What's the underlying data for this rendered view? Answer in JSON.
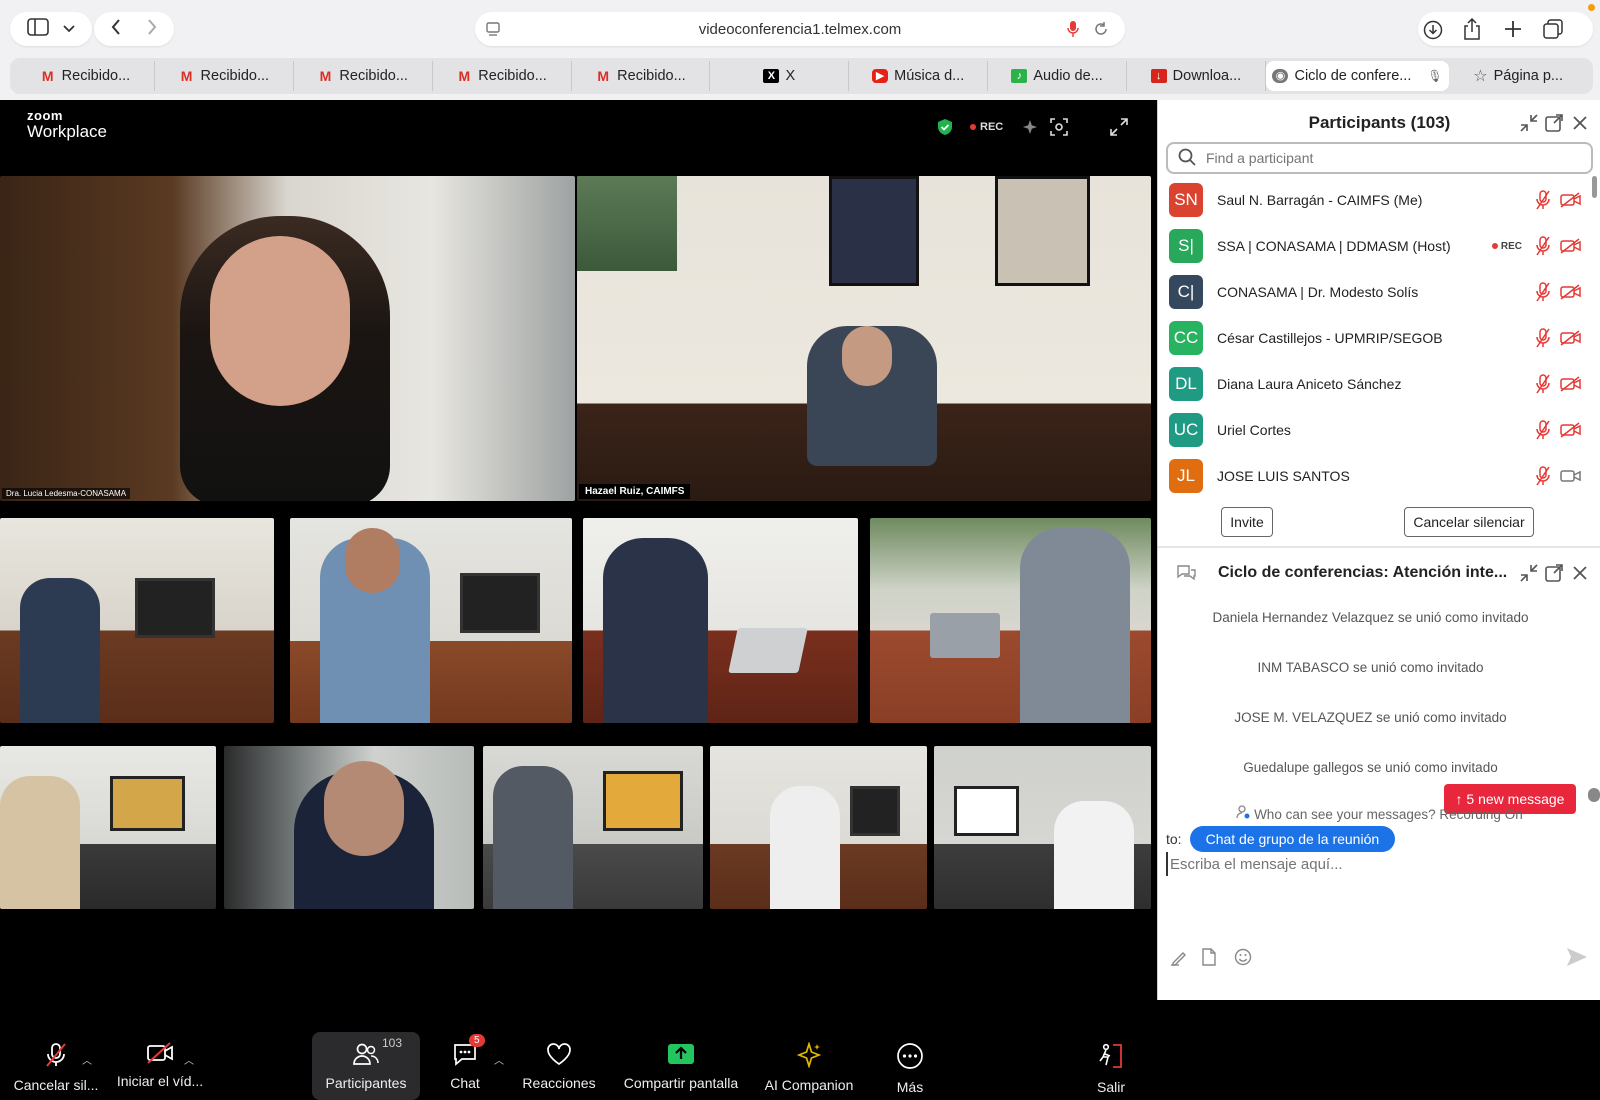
{
  "browser": {
    "url": "videoconferencia1.telmex.com",
    "tabs": [
      {
        "label": "Recibido...",
        "icon": "gmail-icon"
      },
      {
        "label": "Recibido...",
        "icon": "gmail-icon"
      },
      {
        "label": "Recibido...",
        "icon": "gmail-icon"
      },
      {
        "label": "Recibido...",
        "icon": "gmail-icon"
      },
      {
        "label": "Recibido...",
        "icon": "gmail-icon"
      },
      {
        "label": "X",
        "icon": "x-icon"
      },
      {
        "label": "Música d...",
        "icon": "youtube-icon"
      },
      {
        "label": "Audio de...",
        "icon": "audio-icon"
      },
      {
        "label": "Downloa...",
        "icon": "download-icon"
      },
      {
        "label": "Ciclo de confere...",
        "icon": "zoom-icon",
        "active": true
      },
      {
        "label": "Página p...",
        "icon": "star-icon"
      }
    ]
  },
  "zoom": {
    "logo_top": "zoom",
    "logo_bottom": "Workplace",
    "rec_label": "REC",
    "tiles": [
      {
        "name": "Dra. Lucia Ledesma-CONASAMA"
      },
      {
        "name": "Hazael Ruiz, CAIMFS"
      }
    ],
    "toolbar": {
      "mute": "Cancelar sil...",
      "video": "Iniciar el víd...",
      "participants": "Participantes",
      "participants_count": "103",
      "chat": "Chat",
      "chat_badge": "5",
      "reactions": "Reacciones",
      "share": "Compartir pantalla",
      "ai": "AI Companion",
      "more": "Más",
      "leave": "Salir"
    }
  },
  "participants": {
    "title": "Participants (103)",
    "search_placeholder": "Find a participant",
    "list": [
      {
        "initials": "SN",
        "name": "Saul N. Barragán - CAIMFS (Me)",
        "color": "#d9432f",
        "rec": "",
        "video": "off"
      },
      {
        "initials": "S|",
        "name": "SSA | CONASAMA | DDMASM (Host)",
        "color": "#27a85b",
        "rec": "REC",
        "video": "off"
      },
      {
        "initials": "C|",
        "name": "CONASAMA | Dr. Modesto Solís",
        "color": "#36485e",
        "rec": "",
        "video": "off"
      },
      {
        "initials": "CC",
        "name": "César Castillejos - UPMRIP/SEGOB",
        "color": "#27b35f",
        "rec": "",
        "video": "off"
      },
      {
        "initials": "DL",
        "name": "Diana Laura Aniceto Sánchez",
        "color": "#1f9a83",
        "rec": "",
        "video": "off"
      },
      {
        "initials": "UC",
        "name": "Uriel Cortes",
        "color": "#1f9a83",
        "rec": "",
        "video": "off"
      },
      {
        "initials": "JL",
        "name": "JOSE LUIS SANTOS",
        "color": "#e06d0f",
        "rec": "",
        "video": "on"
      }
    ],
    "invite": "Invite",
    "unmute_all": "Cancelar silenciar"
  },
  "chat": {
    "title": "Ciclo de conferencias: Atención inte...",
    "messages": [
      "Daniela Hernandez Velazquez se unió como invitado",
      "INM TABASCO se unió como invitado",
      "JOSE M. VELAZQUEZ se unió como invitado",
      "Guedalupe gallegos se unió como invitado"
    ],
    "new_messages": "↑ 5 new message",
    "who_can_see": "Who can see your messages? Recording On",
    "to_label": "to:",
    "to_target": "Chat de grupo de la reunión",
    "input_placeholder": "Escriba el mensaje aquí..."
  },
  "colors": {
    "accent": "#1c73e8",
    "alert": "#e8273d",
    "share_green": "#22c55e",
    "ai_gold": "#e6b800"
  }
}
